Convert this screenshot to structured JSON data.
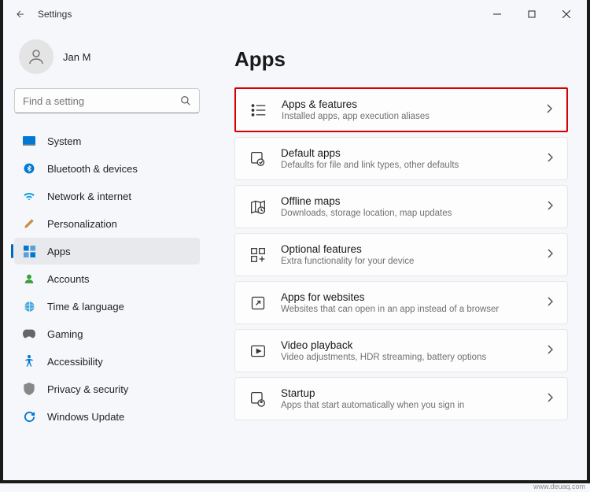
{
  "window": {
    "title": "Settings"
  },
  "user": {
    "name": "Jan M"
  },
  "search": {
    "placeholder": "Find a setting"
  },
  "sidebar": {
    "items": [
      {
        "label": "System"
      },
      {
        "label": "Bluetooth & devices"
      },
      {
        "label": "Network & internet"
      },
      {
        "label": "Personalization"
      },
      {
        "label": "Apps"
      },
      {
        "label": "Accounts"
      },
      {
        "label": "Time & language"
      },
      {
        "label": "Gaming"
      },
      {
        "label": "Accessibility"
      },
      {
        "label": "Privacy & security"
      },
      {
        "label": "Windows Update"
      }
    ]
  },
  "page": {
    "title": "Apps",
    "cards": [
      {
        "title": "Apps & features",
        "subtitle": "Installed apps, app execution aliases"
      },
      {
        "title": "Default apps",
        "subtitle": "Defaults for file and link types, other defaults"
      },
      {
        "title": "Offline maps",
        "subtitle": "Downloads, storage location, map updates"
      },
      {
        "title": "Optional features",
        "subtitle": "Extra functionality for your device"
      },
      {
        "title": "Apps for websites",
        "subtitle": "Websites that can open in an app instead of a browser"
      },
      {
        "title": "Video playback",
        "subtitle": "Video adjustments, HDR streaming, battery options"
      },
      {
        "title": "Startup",
        "subtitle": "Apps that start automatically when you sign in"
      }
    ]
  },
  "attribution": "www.deuaq.com"
}
